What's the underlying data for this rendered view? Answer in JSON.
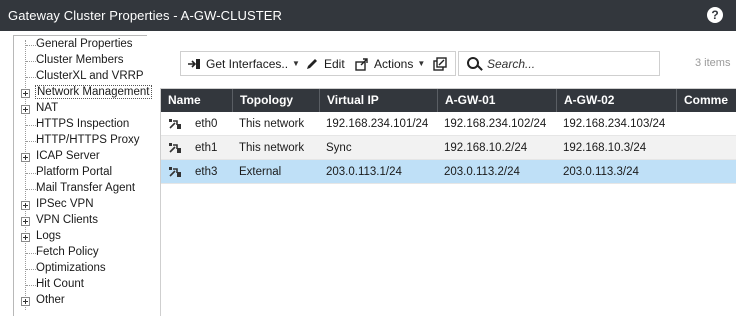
{
  "window": {
    "title": "Gateway Cluster Properties - A-GW-CLUSTER",
    "help": "?"
  },
  "tree": [
    {
      "label": "General Properties",
      "expandable": false
    },
    {
      "label": "Cluster Members",
      "expandable": false
    },
    {
      "label": "ClusterXL and VRRP",
      "expandable": false
    },
    {
      "label": "Network Management",
      "expandable": true,
      "selected": true
    },
    {
      "label": "NAT",
      "expandable": true
    },
    {
      "label": "HTTPS Inspection",
      "expandable": false
    },
    {
      "label": "HTTP/HTTPS Proxy",
      "expandable": false
    },
    {
      "label": "ICAP Server",
      "expandable": true
    },
    {
      "label": "Platform Portal",
      "expandable": false
    },
    {
      "label": "Mail Transfer Agent",
      "expandable": false
    },
    {
      "label": "IPSec VPN",
      "expandable": true
    },
    {
      "label": "VPN Clients",
      "expandable": true
    },
    {
      "label": "Logs",
      "expandable": true
    },
    {
      "label": "Fetch Policy",
      "expandable": false
    },
    {
      "label": "Optimizations",
      "expandable": false
    },
    {
      "label": "Hit Count",
      "expandable": false
    },
    {
      "label": "Other",
      "expandable": true
    }
  ],
  "toolbar": {
    "get_interfaces": "Get Interfaces..",
    "edit": "Edit",
    "actions": "Actions",
    "search_placeholder": "Search...",
    "items_count": "3 items"
  },
  "table": {
    "columns": [
      "Name",
      "Topology",
      "Virtual IP",
      "A-GW-01",
      "A-GW-02",
      "Comme"
    ],
    "rows": [
      {
        "name": "eth0",
        "topology": "This network",
        "virtual_ip": "192.168.234.101/24",
        "gw01": "192.168.234.102/24",
        "gw02": "192.168.234.103/24",
        "comment": ""
      },
      {
        "name": "eth1",
        "topology": "This network",
        "virtual_ip": "Sync",
        "gw01": "192.168.10.2/24",
        "gw02": "192.168.10.3/24",
        "comment": ""
      },
      {
        "name": "eth3",
        "topology": "External",
        "virtual_ip": "203.0.113.1/24",
        "gw01": "203.0.113.2/24",
        "gw02": "203.0.113.3/24",
        "comment": ""
      }
    ]
  },
  "colors": {
    "header_bg": "#33373d",
    "selected_row": "#bfe0f7",
    "alt_row": "#f2f2f2"
  },
  "icons": [
    "help-icon",
    "expand-plus-icon",
    "get-interfaces-icon",
    "pencil-icon",
    "actions-icon",
    "detach-window-icon",
    "search-icon",
    "interface-icon"
  ]
}
